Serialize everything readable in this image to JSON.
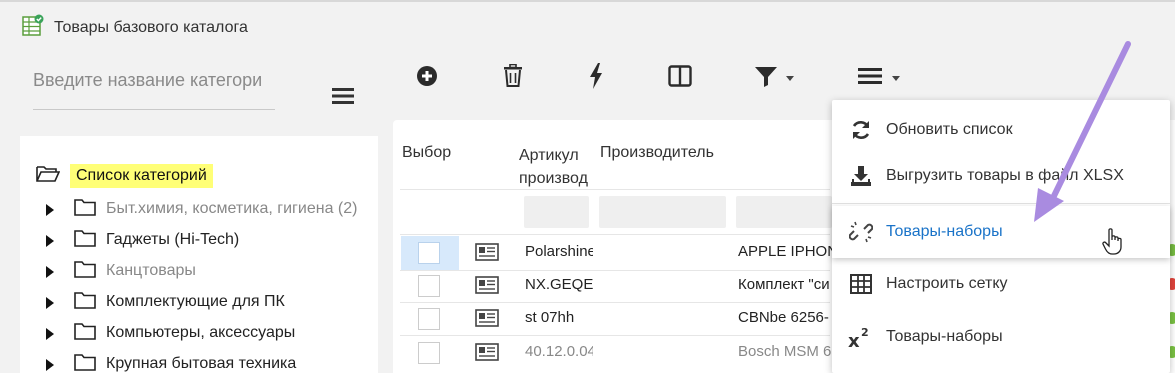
{
  "app": {
    "title": "Товары базового каталога"
  },
  "search": {
    "placeholder": "Введите название категори"
  },
  "toolbar": {
    "buttons": [
      "add-icon",
      "trash-icon",
      "lightning-icon",
      "columns-icon",
      "filter-icon",
      "menu-icon"
    ]
  },
  "tree": {
    "root_label": "Список категорий",
    "items": [
      {
        "label": "Быт.химия, косметика, гигиена (2)",
        "color": "#888888"
      },
      {
        "label": "Гаджеты (Hi-Tech)",
        "color": "#222222"
      },
      {
        "label": "Канцтовары",
        "color": "#888888"
      },
      {
        "label": "Комплектующие для ПК",
        "color": "#222222"
      },
      {
        "label": "Компьютеры, аксессуары",
        "color": "#222222"
      },
      {
        "label": "Крупная бытовая техника",
        "color": "#222222"
      }
    ]
  },
  "table": {
    "headers": {
      "select": "Выбор",
      "article": "Артикул производ",
      "manufacturer": "Производитель"
    },
    "rows": [
      {
        "article": "Polarshine",
        "name": "APPLE IPHON"
      },
      {
        "article": "NX.GEQEF",
        "name": "Комплект \"си"
      },
      {
        "article": "st 07hh",
        "name": "CBNbe 6256-"
      },
      {
        "article": "40.12.0.04",
        "name": "Bosch MSM 6"
      }
    ]
  },
  "menu": {
    "items": [
      {
        "label": "Обновить список",
        "icon": "refresh-icon"
      },
      {
        "label": "Выгрузить товары в файл XLSX",
        "icon": "download-icon"
      },
      {
        "label": "Товары-наборы",
        "icon": "broken-link-icon"
      },
      {
        "label": "Настроить сетку",
        "icon": "grid-icon"
      },
      {
        "label": "Товары-наборы",
        "icon": "superscript-x2-icon"
      }
    ]
  },
  "colors": {
    "highlight": "#ffff77",
    "link_blue": "#1a73c8",
    "arrow_purple": "#a98be0"
  }
}
